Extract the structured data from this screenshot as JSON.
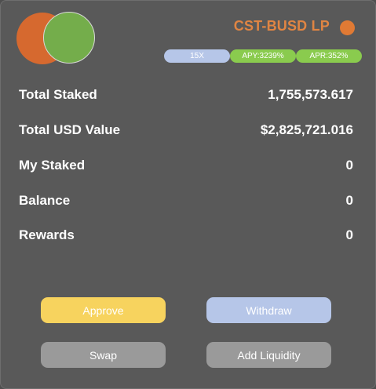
{
  "pool": {
    "title": "CST-BUSD LP",
    "token_icons": [
      "orange-token-icon",
      "green-token-icon"
    ],
    "status_dot_color": "#e07a34"
  },
  "badges": {
    "multiplier": "15X",
    "apy": "APY:3239%",
    "apr": "APR:352%"
  },
  "stats": [
    {
      "label": "Total Staked",
      "value": "1,755,573.617"
    },
    {
      "label": "Total USD Value",
      "value": "$2,825,721.016"
    },
    {
      "label": "My Staked",
      "value": "0"
    },
    {
      "label": "Balance",
      "value": "0"
    },
    {
      "label": "Rewards",
      "value": "0"
    }
  ],
  "buttons": {
    "approve": "Approve",
    "withdraw": "Withdraw",
    "swap": "Swap",
    "add_liquidity": "Add Liquidity"
  },
  "colors": {
    "title": "#e08543",
    "approve": "#f7d35e",
    "withdraw": "#b6c6e8",
    "secondary": "#9a9a9a",
    "badge_green": "#8acb4e",
    "badge_blue": "#b6c6e8"
  }
}
